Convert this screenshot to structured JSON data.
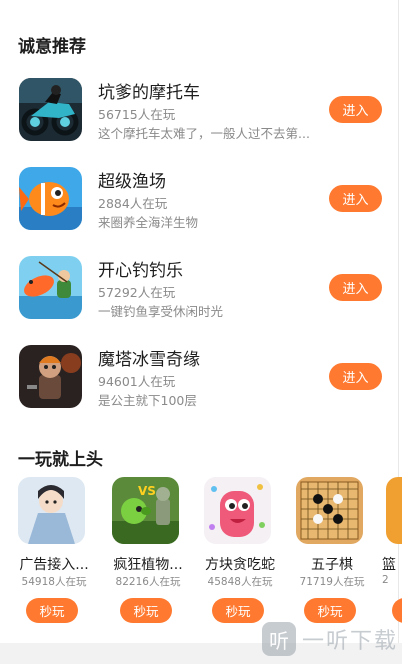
{
  "sections": {
    "recommended_title": "诚意推荐",
    "hot_title": "一玩就上头"
  },
  "recommended": [
    {
      "name": "坑爹的摩托车",
      "count": "56715人在玩",
      "desc": "这个摩托车太难了，一般人过不去第...",
      "button": "进入",
      "icon": "motorcycle-game-icon"
    },
    {
      "name": "超级渔场",
      "count": "2884人在玩",
      "desc": "来圈养全海洋生物",
      "button": "进入",
      "icon": "clownfish-game-icon"
    },
    {
      "name": "开心钓钓乐",
      "count": "57292人在玩",
      "desc": "一键钓鱼享受休闲时光",
      "button": "进入",
      "icon": "fishing-game-icon"
    },
    {
      "name": "魔塔冰雪奇缘",
      "count": "94601人在玩",
      "desc": "是公主就下100层",
      "button": "进入",
      "icon": "magic-tower-game-icon"
    }
  ],
  "hot": [
    {
      "name": "广告接入...",
      "count": "54918人在玩",
      "button": "秒玩",
      "icon": "anime-character-game-icon"
    },
    {
      "name": "疯狂植物...",
      "count": "82216人在玩",
      "button": "秒玩",
      "icon": "plants-zombies-game-icon"
    },
    {
      "name": "方块贪吃蛇",
      "count": "45848人在玩",
      "button": "秒玩",
      "icon": "snake-game-icon"
    },
    {
      "name": "五子棋",
      "count": "71719人在玩",
      "button": "秒玩",
      "icon": "gomoku-board-icon"
    },
    {
      "name": "篮",
      "count": "2",
      "button": "秒",
      "icon": "basketball-game-icon"
    }
  ],
  "watermark": {
    "logo": "听",
    "text": "一听下载"
  },
  "colors": {
    "accent": "#ff7a30",
    "muted": "#8a8a8a"
  }
}
